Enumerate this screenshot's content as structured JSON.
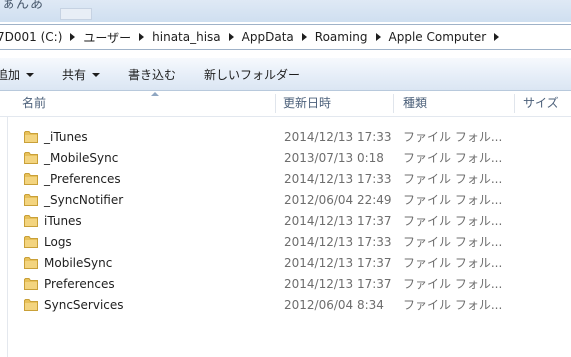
{
  "address_bar": {
    "crumbs": [
      "7D001 (C:)",
      "ユーザー",
      "hinata_hisa",
      "AppData",
      "Roaming",
      "Apple Computer"
    ]
  },
  "toolbar": {
    "add_label": "追加",
    "share_label": "共有",
    "burn_label": "書き込む",
    "new_folder_label": "新しいフォルダー"
  },
  "columns": {
    "name": "名前",
    "date": "更新日時",
    "type": "種類",
    "size": "サイズ"
  },
  "files": [
    {
      "name": "_iTunes",
      "date": "2014/12/13 17:33",
      "type": "ファイル フォル..."
    },
    {
      "name": "_MobileSync",
      "date": "2013/07/13 0:18",
      "type": "ファイル フォル..."
    },
    {
      "name": "_Preferences",
      "date": "2014/12/13 17:33",
      "type": "ファイル フォル..."
    },
    {
      "name": "_SyncNotifier",
      "date": "2012/06/04 22:49",
      "type": "ファイル フォル..."
    },
    {
      "name": "iTunes",
      "date": "2014/12/13 17:37",
      "type": "ファイル フォル..."
    },
    {
      "name": "Logs",
      "date": "2014/12/13 17:33",
      "type": "ファイル フォル..."
    },
    {
      "name": "MobileSync",
      "date": "2014/12/13 17:37",
      "type": "ファイル フォル..."
    },
    {
      "name": "Preferences",
      "date": "2014/12/13 17:37",
      "type": "ファイル フォル..."
    },
    {
      "name": "SyncServices",
      "date": "2012/06/04 8:34",
      "type": "ファイル フォル..."
    }
  ],
  "colors": {
    "folder": "#e8c15a",
    "header_text": "#4c607a",
    "meta_text": "#6d6d6d"
  }
}
